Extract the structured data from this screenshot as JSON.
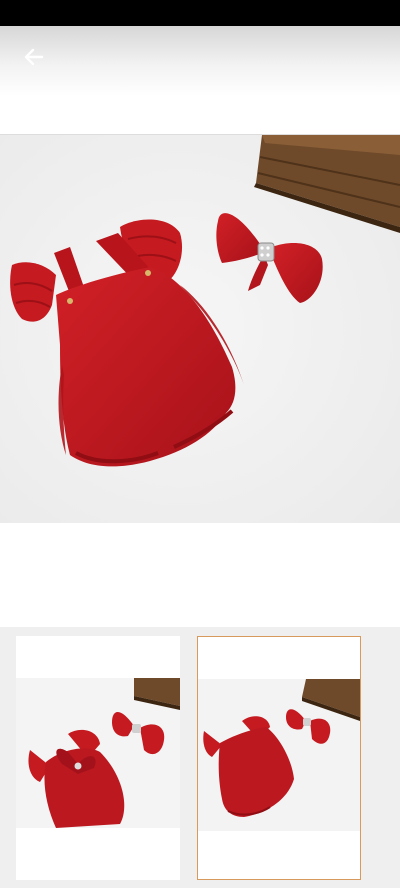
{
  "icons": {
    "back": "arrow-left-icon"
  },
  "colors": {
    "toolbar_icon": "#ffffff",
    "selected_thumbnail_border": "#d89a5c",
    "product_red": "#c4161c"
  },
  "gallery": {
    "selected_index": 1,
    "thumbnails": [
      {
        "selected": false
      },
      {
        "selected": true
      }
    ]
  }
}
